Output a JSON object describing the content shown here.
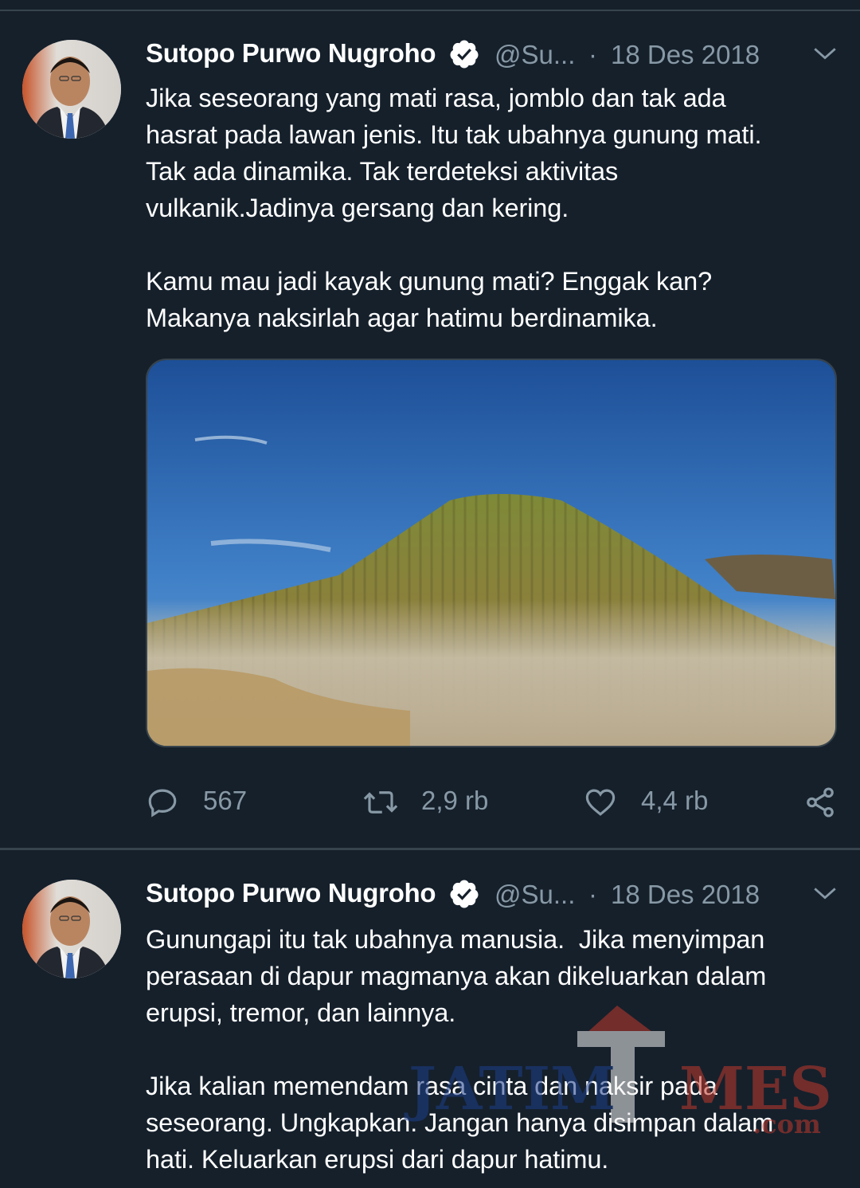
{
  "tweets": [
    {
      "author": "Sutopo Purwo Nugroho",
      "handle": "@Su...",
      "separator": "·",
      "date": "18 Des 2018",
      "text": "Jika seseorang yang mati rasa, jomblo dan tak ada\nhasrat pada lawan jenis. Itu tak ubahnya gunung mati.\nTak ada dinamika. Tak terdeteksi aktivitas\nvulkanik.Jadinya gersang dan kering.\n\nKamu mau jadi kayak gunung mati? Enggak kan?\nMakanya naksirlah agar hatimu berdinamika.",
      "replies": "567",
      "retweets": "2,9 rb",
      "likes": "4,4 rb"
    },
    {
      "author": "Sutopo Purwo Nugroho",
      "handle": "@Su...",
      "separator": "·",
      "date": "18 Des 2018",
      "text": "Gunungapi itu tak ubahnya manusia.  Jika menyimpan\nperasaan di dapur magmanya akan dikeluarkan dalam\nerupsi, tremor, dan lainnya.\n\nJika kalian memendam rasa cinta dan naksir pada\nseseorang. Ungkapkan. Jangan hanya disimpan dalam\nhati. Keluarkan erupsi dari dapur hatimu."
    }
  ],
  "watermark": {
    "brand_left": "JATIM",
    "brand_right": "MES",
    "brand_mid": "T",
    "suffix": ".com"
  },
  "colors": {
    "background": "#15202b",
    "muted_text": "#8899a6",
    "divider": "#38444d",
    "verified_badge": "#ffffff"
  },
  "icons": [
    "verified-badge-icon",
    "chevron-down-icon",
    "reply-icon",
    "retweet-icon",
    "like-icon",
    "share-icon"
  ]
}
